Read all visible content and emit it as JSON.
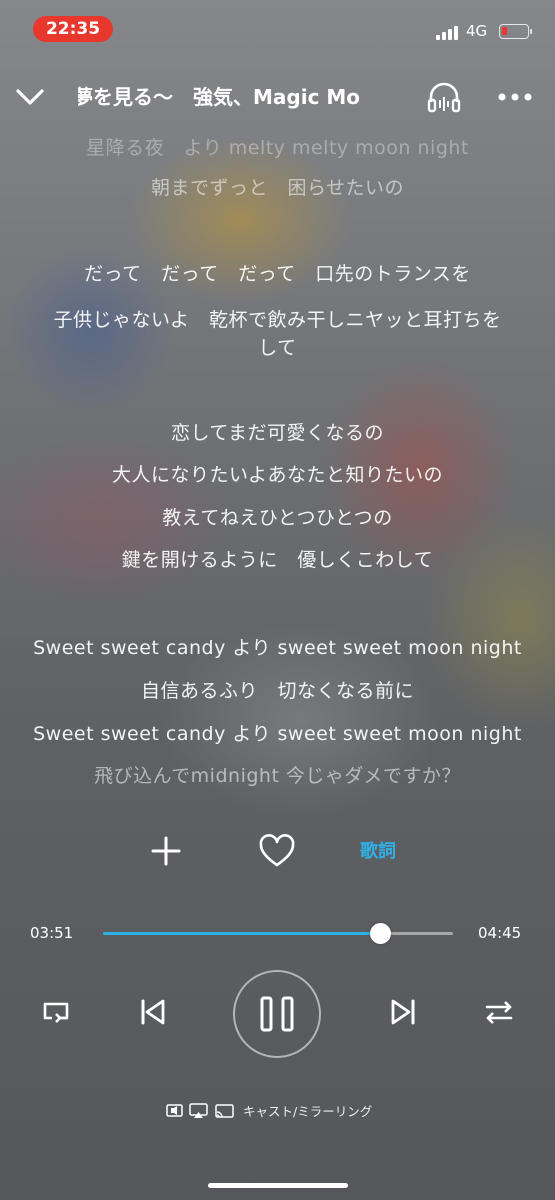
{
  "status": {
    "time": "22:35",
    "network": "4G"
  },
  "header": {
    "title": "夢を見る〜　強気、Magic Mo"
  },
  "lyrics": [
    {
      "text": "星降る夜　より melty melty moon night",
      "style": "dimmer"
    },
    {
      "text": "朝までずっと　困らせたいの",
      "style": "dim"
    },
    {
      "text": "だって　だって　だって　口先のトランスを",
      "style": ""
    },
    {
      "text": "子供じゃないよ　乾杯で飲み干しニヤッと耳打ちを",
      "style": ""
    },
    {
      "text": "して",
      "style": ""
    },
    {
      "text": "恋してまだ可愛くなるの",
      "style": ""
    },
    {
      "text": "大人になりたいよあなたと知りたいの",
      "style": ""
    },
    {
      "text": "教えてねえひとつひとつの",
      "style": ""
    },
    {
      "text": "鍵を開けるように　優しくこわして",
      "style": ""
    },
    {
      "text": "Sweet sweet candy より sweet sweet moon night",
      "style": ""
    },
    {
      "text": "自信あるふり　切なくなる前に",
      "style": ""
    },
    {
      "text": "Sweet sweet candy より sweet sweet moon night",
      "style": ""
    },
    {
      "text": "飛び込んでmidnight  今じゃダメですか？",
      "style": "dim"
    }
  ],
  "actions": {
    "lyrics_label": "歌詞",
    "add_icon": "plus-icon",
    "favorite_icon": "heart-icon"
  },
  "player": {
    "elapsed": "03:51",
    "total": "04:45",
    "progress": 0.79,
    "accent_color": "#2fb0e6"
  },
  "cast": {
    "label": "キャスト/ミラーリング"
  }
}
